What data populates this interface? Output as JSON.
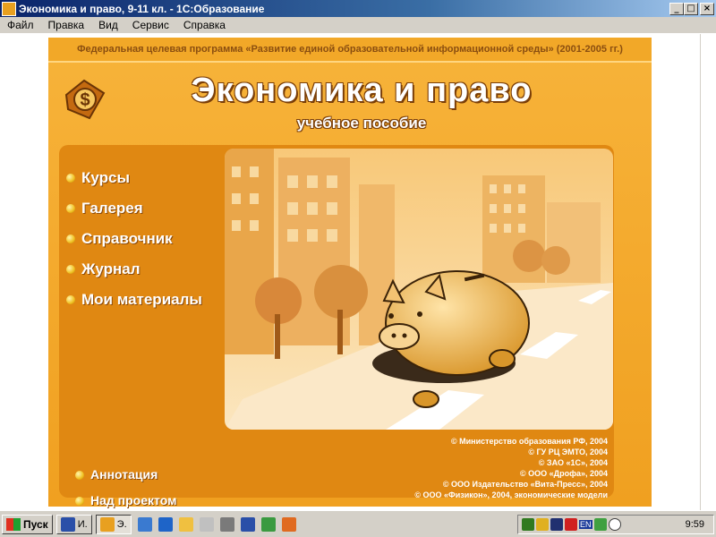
{
  "window": {
    "title": "Экономика и право, 9-11 кл. - 1С:Образование"
  },
  "menu": [
    "Файл",
    "Правка",
    "Вид",
    "Сервис",
    "Справка"
  ],
  "header": {
    "program": "Федеральная целевая программа  «Развитие единой образовательной информационной среды» (2001-2005 гг.)",
    "title": "Экономика и право",
    "subtitle": "учебное пособие"
  },
  "nav": [
    "Курсы",
    "Галерея",
    "Справочник",
    "Журнал",
    "Мои материалы"
  ],
  "bottom_nav": [
    "Аннотация",
    "Над проектом работали"
  ],
  "copyrights": [
    "© Министерство образования РФ, 2004",
    "© ГУ РЦ ЭМТО, 2004",
    "© ЗАО «1С», 2004",
    "© ООО «Дрофа», 2004",
    "© ООО Издательство «Вита-Пресс», 2004",
    "© ООО «Физикон», 2004, экономические модели"
  ],
  "taskbar": {
    "start": "Пуск",
    "tasks": [
      "И.",
      "Э."
    ],
    "clock": "9:59",
    "lang": "EN"
  },
  "colors": {
    "orange": "#f0a020",
    "dark_orange": "#e08812",
    "brown": "#7a3e08"
  }
}
